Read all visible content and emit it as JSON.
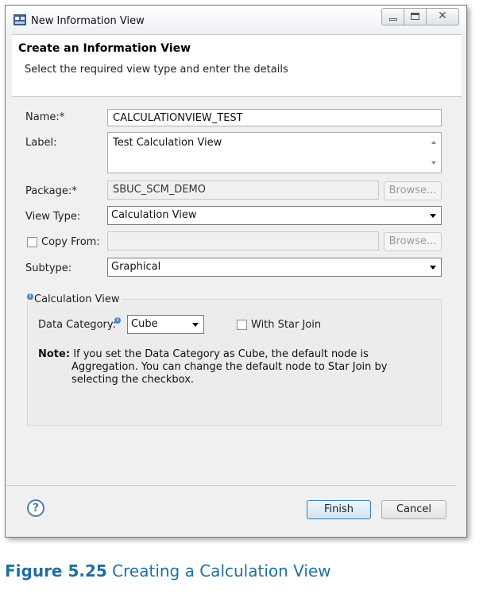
{
  "window": {
    "title": "New Information View",
    "close_glyph": "✕"
  },
  "header": {
    "title": "Create an Information View",
    "description": "Select the required view type and enter the details"
  },
  "form": {
    "name_label": "Name:*",
    "name_value": "CALCULATIONVIEW_TEST",
    "label_label": "Label:",
    "label_value": "Test Calculation View",
    "package_label": "Package:*",
    "package_value": "SBUC_SCM_DEMO",
    "browse_label": "Browse...",
    "view_type_label": "View Type:",
    "view_type_value": "Calculation View",
    "copy_from_label": "Copy From:",
    "copy_from_value": "",
    "copy_from_checked": false,
    "subtype_label": "Subtype:",
    "subtype_value": "Graphical"
  },
  "calc_group": {
    "title": "Calculation View",
    "data_category_label": "Data Category:",
    "data_category_value": "Cube",
    "star_join_label": "With Star Join",
    "star_join_checked": false,
    "note_label": "Note:",
    "note_line1": "If you set the Data Category as Cube, the default node is",
    "note_line2": "Aggregation. You can change the default node to Star Join by",
    "note_line3": "selecting the checkbox."
  },
  "footer": {
    "help_glyph": "?",
    "finish_label": "Finish",
    "cancel_label": "Cancel"
  },
  "caption": {
    "figure_label": "Figure 5.25",
    "text": "Creating a Calculation View"
  },
  "colors": {
    "accent": "#1f6f9f",
    "info": "#4a86c7"
  },
  "icons": [
    "app-icon",
    "minimize-icon",
    "maximize-icon",
    "close-icon",
    "info-icon",
    "help-icon",
    "chevron-down-icon"
  ]
}
